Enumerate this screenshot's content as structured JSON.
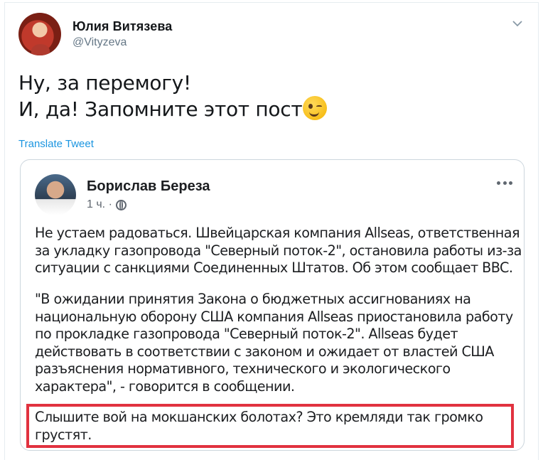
{
  "tweet": {
    "author_name": "Юлия Витязева",
    "author_handle": "@Vityzeva",
    "text_lines": [
      "Ну, за перемогу!",
      "И, да! Запомните этот пост"
    ],
    "emoji": "winking-face",
    "translate_label": "Translate Tweet"
  },
  "embedded_post": {
    "author_name": "Борислав Береза",
    "time": "1 ч. ·",
    "paragraph1": [
      "Не устаем радоваться. Швейцарская компания Allseas, ответственная",
      "за укладку газопровода \"Северный поток-2\", остановила работы из-за",
      "ситуации с санкциями Соединенных Штатов. Об этом сообщает BBC."
    ],
    "paragraph2": [
      "\"В ожидании принятия Закона о бюджетных ассигнованиях на",
      "национальную оборону США компания Allseas приостановила работу",
      "по прокладке газопровода \"Северный поток-2\". Allseas будет",
      "действовать в соответствии с законом и ожидает от властей США",
      "разъяснения нормативного, технического и экологического",
      "характера\", - говорится в сообщении."
    ],
    "highlighted_paragraph": [
      "Слышите вой на мокшанских болотах? Это кремляди так громко",
      "грустят."
    ],
    "highlight_color": "#e1323f"
  }
}
